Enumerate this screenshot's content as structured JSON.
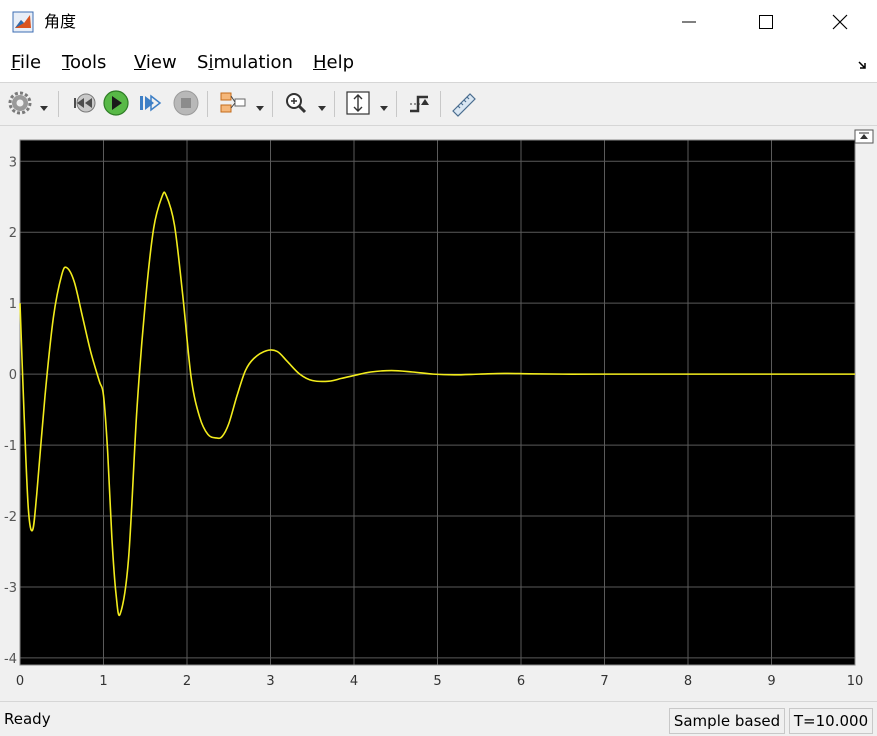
{
  "window": {
    "title": "角度",
    "controls": [
      "minimize-icon",
      "maximize-icon",
      "close-icon"
    ]
  },
  "menu": {
    "items": [
      {
        "label": "File",
        "mnemonic": "F"
      },
      {
        "label": "Tools",
        "mnemonic": "T"
      },
      {
        "label": "View",
        "mnemonic": "V"
      },
      {
        "label": "Simulation",
        "mnemonic": "i"
      },
      {
        "label": "Help",
        "mnemonic": "H"
      }
    ]
  },
  "toolbar": {
    "icons": [
      "configuration-gear-icon",
      "step-back-icon",
      "run-icon",
      "step-forward-icon",
      "stop-icon",
      "highlight-simulink-block-icon",
      "zoom-in-icon",
      "scale-axes-icon",
      "trigger-icon",
      "measurements-icon"
    ]
  },
  "status": {
    "left": "Ready",
    "mode": "Sample based",
    "time": "T=10.000"
  },
  "colors": {
    "plot_background": "#000000",
    "grid": "#5a5a5a",
    "signal": "#f2ec1c",
    "tick_text": "#bfbfbf"
  },
  "chart_data": {
    "type": "line",
    "title": "",
    "xlabel": "",
    "ylabel": "",
    "xlim": [
      0,
      10
    ],
    "ylim": [
      -4.1,
      3.3
    ],
    "grid": true,
    "xticks": [
      "0",
      "1",
      "2",
      "3",
      "4",
      "5",
      "6",
      "7",
      "8",
      "9",
      "10"
    ],
    "yticks": [
      "3",
      "2",
      "1",
      "0",
      "-1",
      "-2",
      "-3",
      "-4"
    ],
    "series": [
      {
        "color": "#f2ec1c",
        "x": [
          0,
          0.05,
          0.1,
          0.15,
          0.2,
          0.3,
          0.4,
          0.5,
          0.56,
          0.65,
          0.75,
          0.85,
          0.95,
          1.0,
          1.05,
          1.1,
          1.15,
          1.2,
          1.3,
          1.4,
          1.5,
          1.6,
          1.7,
          1.75,
          1.85,
          1.95,
          2.05,
          2.15,
          2.25,
          2.35,
          2.42,
          2.5,
          2.6,
          2.7,
          2.8,
          2.95,
          3.08,
          3.2,
          3.35,
          3.5,
          3.7,
          3.85,
          4.0,
          4.2,
          4.45,
          4.7,
          4.95,
          5.2,
          5.5,
          5.8,
          6.1,
          6.5,
          7.0,
          8.0,
          9.0,
          10.0
        ],
        "y": [
          1.0,
          -0.6,
          -1.9,
          -2.2,
          -1.7,
          -0.3,
          0.8,
          1.4,
          1.5,
          1.3,
          0.8,
          0.3,
          -0.1,
          -0.3,
          -1.1,
          -2.3,
          -3.1,
          -3.38,
          -2.6,
          -0.5,
          1.0,
          2.05,
          2.5,
          2.52,
          2.1,
          1.1,
          -0.05,
          -0.6,
          -0.85,
          -0.9,
          -0.88,
          -0.7,
          -0.3,
          0.05,
          0.22,
          0.33,
          0.32,
          0.18,
          0.0,
          -0.09,
          -0.1,
          -0.06,
          -0.02,
          0.03,
          0.05,
          0.03,
          0.0,
          -0.01,
          0.0,
          0.01,
          0.005,
          0.0,
          0.0,
          0.0,
          0.0,
          0.0
        ]
      }
    ]
  }
}
